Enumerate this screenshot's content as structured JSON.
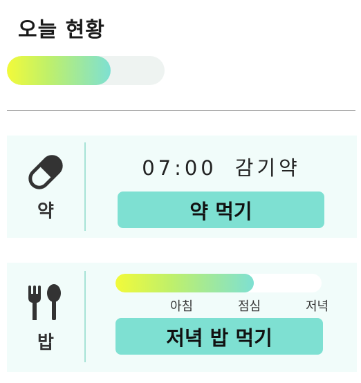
{
  "header": {
    "title": "오늘 현황"
  },
  "overall_progress": {
    "value": 0.66
  },
  "medicine": {
    "label": "약",
    "time": "07:00",
    "name": "감기약",
    "button_label": "약 먹기",
    "icon": "pill-icon"
  },
  "meal": {
    "label": "밥",
    "progress": 0.67,
    "stages": [
      "아침",
      "점심",
      "저녁"
    ],
    "button_label": "저녁 밥 먹기",
    "icon": "fork-spoon-icon"
  },
  "colors": {
    "accent": "#7ee0d2",
    "card_bg": "#f1fcfa",
    "gradient_start": "#f2fa3a",
    "gradient_end": "#7ee0d2"
  }
}
